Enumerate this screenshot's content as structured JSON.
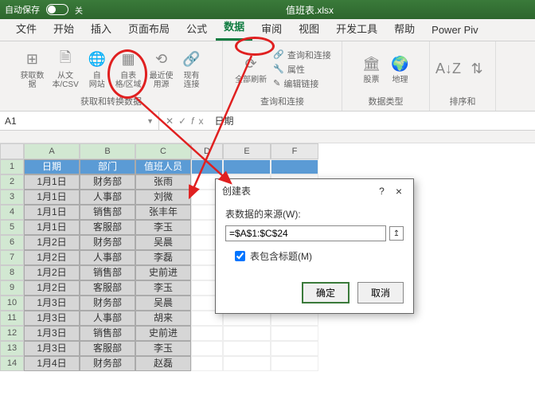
{
  "titlebar": {
    "autosave": "自动保存",
    "autosave_state": "关",
    "filename": "值班表.xlsx"
  },
  "tabs": [
    "文件",
    "开始",
    "插入",
    "页面布局",
    "公式",
    "数据",
    "审阅",
    "视图",
    "开发工具",
    "帮助",
    "Power Piv"
  ],
  "active_tab": 5,
  "ribbon": {
    "g1": {
      "label": "获取和转换数据",
      "btns": [
        [
          "获取数",
          "据"
        ],
        [
          "从文",
          "本/CSV"
        ],
        [
          "自",
          "网站"
        ],
        [
          "自表",
          "格/区域"
        ],
        [
          "最近使",
          "用源"
        ],
        [
          "现有",
          "连接"
        ]
      ]
    },
    "g2": {
      "label": "查询和连接",
      "main": "全部刷新",
      "items": [
        "查询和连接",
        "属性",
        "编辑链接"
      ]
    },
    "g3": {
      "label": "数据类型",
      "items": [
        "股票",
        "地理"
      ]
    },
    "g4": {
      "label": "排序和"
    }
  },
  "namebox": {
    "ref": "A1",
    "value": "日期"
  },
  "columns": [
    "A",
    "B",
    "C",
    "D",
    "E",
    "F"
  ],
  "headers": [
    "日期",
    "部门",
    "值班人员"
  ],
  "rows": [
    [
      "1月1日",
      "财务部",
      "张雨"
    ],
    [
      "1月1日",
      "人事部",
      "刘微"
    ],
    [
      "1月1日",
      "销售部",
      "张丰年"
    ],
    [
      "1月1日",
      "客服部",
      "李玉"
    ],
    [
      "1月2日",
      "财务部",
      "吴晨"
    ],
    [
      "1月2日",
      "人事部",
      "李磊"
    ],
    [
      "1月2日",
      "销售部",
      "史前进"
    ],
    [
      "1月2日",
      "客服部",
      "李玉"
    ],
    [
      "1月3日",
      "财务部",
      "吴晨"
    ],
    [
      "1月3日",
      "人事部",
      "胡来"
    ],
    [
      "1月3日",
      "销售部",
      "史前进"
    ],
    [
      "1月3日",
      "客服部",
      "李玉"
    ],
    [
      "1月4日",
      "财务部",
      "赵磊"
    ]
  ],
  "dialog": {
    "title": "创建表",
    "source_label": "表数据的来源(W):",
    "range": "=$A$1:$C$24",
    "checkbox": "表包含标题(M)",
    "checked": true,
    "ok": "确定",
    "cancel": "取消",
    "help": "?",
    "close": "×"
  }
}
